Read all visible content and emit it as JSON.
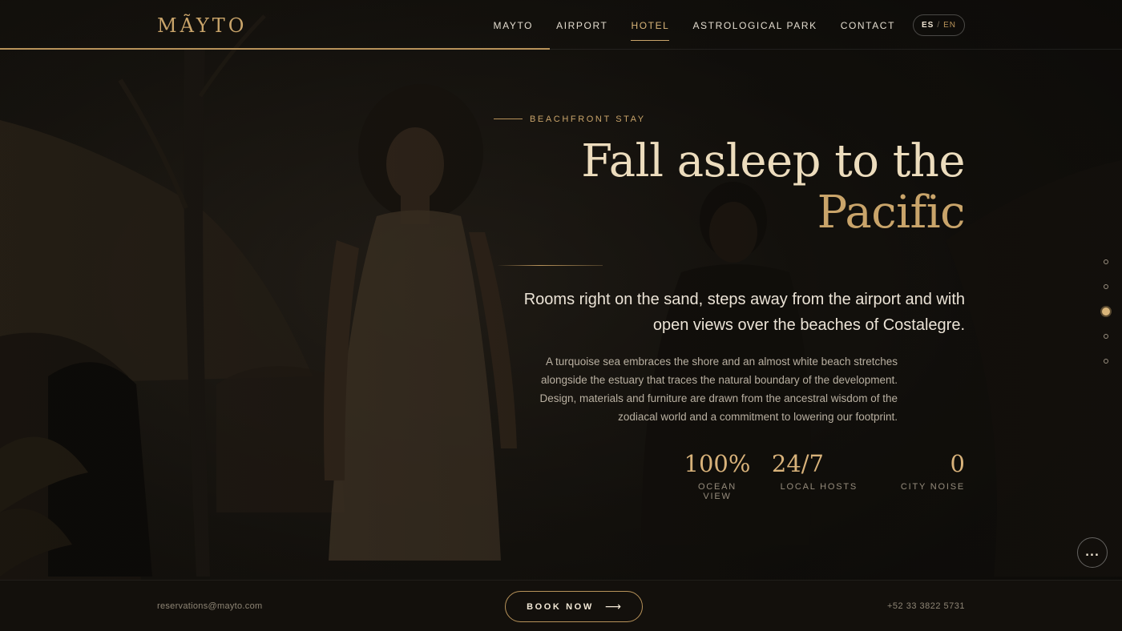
{
  "brand": {
    "logo_text": "MÃYTO",
    "accent_color": "#c9a46a"
  },
  "nav": {
    "items": [
      {
        "label": "MAYTO",
        "active": false
      },
      {
        "label": "AIRPORT",
        "active": false
      },
      {
        "label": "HOTEL",
        "active": true
      },
      {
        "label": "ASTROLOGICAL PARK",
        "active": false
      },
      {
        "label": "CONTACT",
        "active": false
      }
    ],
    "language": {
      "es": "ES",
      "separator": "/",
      "en": "EN",
      "selected": "ES"
    }
  },
  "header": {
    "scroll_progress": 0.49
  },
  "hero": {
    "eyebrow": "BEACHFRONT STAY",
    "title_line1": "Fall asleep to the",
    "title_line2": "Pacific",
    "lead": "Rooms right on the sand, steps away from the airport and with open views over the beaches of Costalegre.",
    "body": "A turquoise sea embraces the shore and an almost white beach stretches alongside the estuary that traces the natural boundary of the development. Design, materials and furniture are drawn from the ancestral wisdom of the zodiacal world and a commitment to lowering our footprint.",
    "stats": [
      {
        "value": "100%",
        "label": "OCEAN VIEW"
      },
      {
        "value": "24/7",
        "label": "LOCAL HOSTS"
      },
      {
        "value": "0",
        "label": "CITY NOISE"
      }
    ]
  },
  "section_nav": {
    "count": 5,
    "active_index": 2
  },
  "more_button": {
    "label": "..."
  },
  "footer": {
    "email": "reservations@mayto.com",
    "book_label": "BOOK NOW",
    "book_arrow": "⟶",
    "phone": "+52 33 3822 5731"
  }
}
